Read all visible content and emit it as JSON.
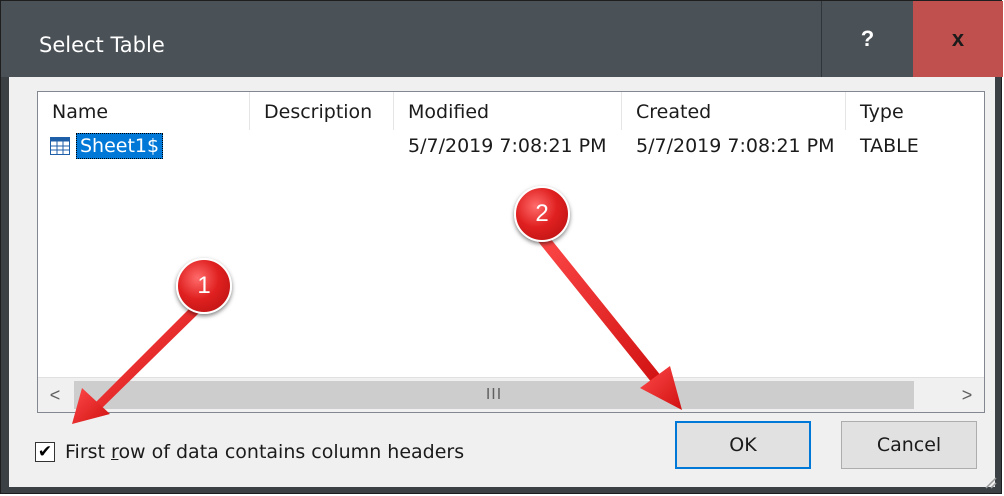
{
  "window": {
    "title": "Select Table",
    "help_label": "?",
    "close_label": "x"
  },
  "list": {
    "columns": [
      "Name",
      "Description",
      "Modified",
      "Created",
      "Type"
    ],
    "rows": [
      {
        "name": "Sheet1$",
        "description": "",
        "modified": "5/7/2019 7:08:21 PM",
        "created": "5/7/2019 7:08:21 PM",
        "type": "TABLE",
        "icon": "table-icon",
        "selected": true
      }
    ],
    "scroll_left": "<",
    "scroll_right": ">",
    "scroll_thumb": "III"
  },
  "options": {
    "checkbox_prefix": "First ",
    "checkbox_accel": "r",
    "checkbox_suffix": "ow of data contains column headers",
    "checked": true
  },
  "buttons": {
    "ok": "OK",
    "cancel": "Cancel"
  },
  "annotations": {
    "badge1": "1",
    "badge2": "2",
    "color": "#e02020"
  }
}
